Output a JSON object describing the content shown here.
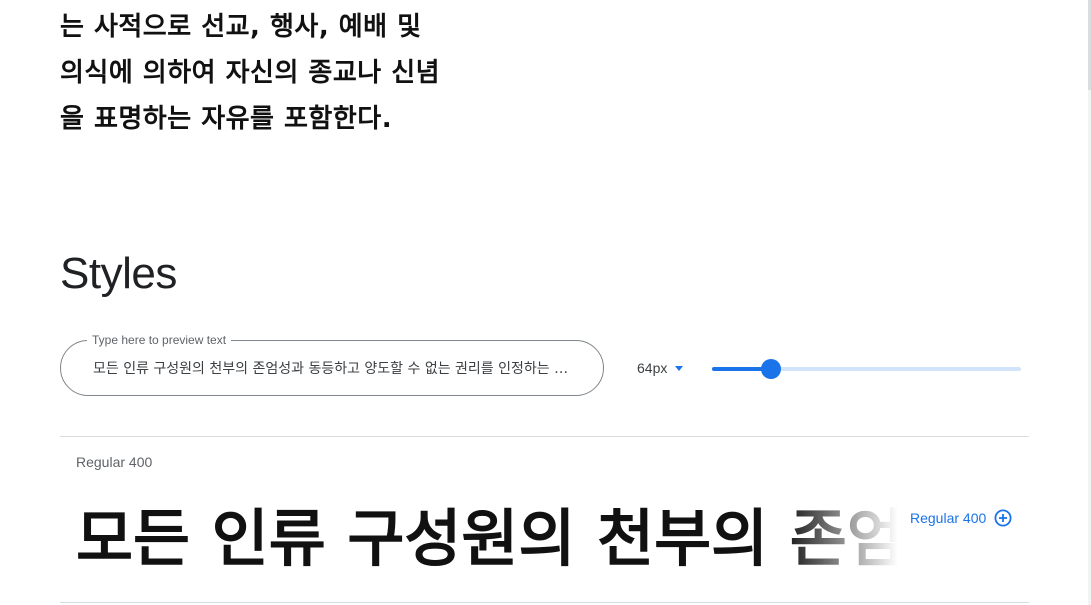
{
  "sample_paragraph": {
    "lines": [
      "는 사적으로 선교, 행사, 예배 및",
      "의식에 의하여 자신의 종교나 신념",
      "을 표명하는 자유를 포함한다."
    ]
  },
  "styles_section": {
    "heading": "Styles"
  },
  "preview_controls": {
    "field_label": "Type here to preview text",
    "field_value": "모든 인류 구성원의 천부의 존엄성과 동등하고 양도할 수 없는 권리를 인정하는 것이 세계의 자유, 정의 및 평화의 기초이며",
    "size_label": "64px",
    "size_slider_fraction": 0.19,
    "accent_color": "#1a73e8"
  },
  "style_rows": [
    {
      "name": "Regular 400",
      "preview_text": "모든 인류 구성원의 천부의 존엄성과 동등하고",
      "button_label": "Regular 400",
      "button_icon": "plus-circle-icon"
    }
  ]
}
